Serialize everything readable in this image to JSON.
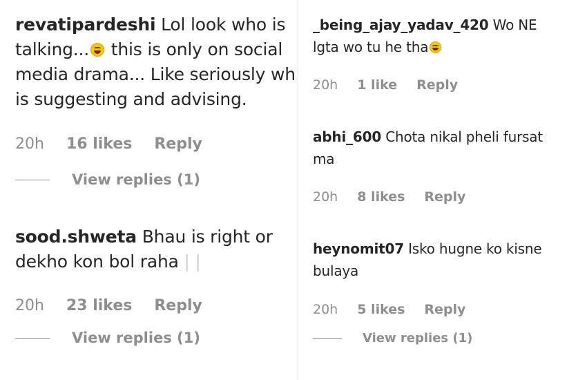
{
  "left": {
    "comments": [
      {
        "username": "revatipardeshi",
        "lines": [
          "Lol look who is",
          "talking...",
          " this is only on social",
          "media drama... Like seriously wh",
          "is suggesting and advising."
        ],
        "emoji": "laughing-emoji",
        "time": "20h",
        "likes": "16 likes",
        "reply": "Reply",
        "view_replies": "View replies (1)"
      },
      {
        "username": "sood.shweta",
        "lines": [
          "Bhau is right or",
          "dekho kon bol raha",
          "| |"
        ],
        "time": "20h",
        "likes": "23 likes",
        "reply": "Reply",
        "view_replies": "View replies (1)"
      }
    ]
  },
  "right": {
    "comments": [
      {
        "username": "_being_ajay_yadav_420",
        "lines": [
          "Wo NE",
          "lgta wo tu he tha"
        ],
        "emoji": "laughing-emoji",
        "time": "20h",
        "likes": "1 like",
        "reply": "Reply"
      },
      {
        "username": "abhi_600",
        "lines": [
          "Chota nikal pheli fursat",
          "ma"
        ],
        "time": "20h",
        "likes": "8 likes",
        "reply": "Reply"
      },
      {
        "username": "heynomit07",
        "lines": [
          "Isko hugne ko kisne",
          "bulaya"
        ],
        "time": "20h",
        "likes": "5 likes",
        "reply": "Reply",
        "view_replies": "View replies (1)"
      }
    ]
  }
}
